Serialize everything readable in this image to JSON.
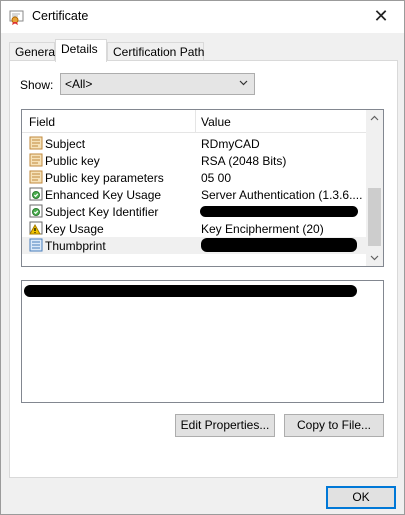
{
  "window": {
    "title": "Certificate",
    "close_glyph": "✕"
  },
  "tabs": [
    {
      "label": "General"
    },
    {
      "label": "Details"
    },
    {
      "label": "Certification Path"
    }
  ],
  "active_tab": "Details",
  "show": {
    "label": "Show:",
    "value": "<All>"
  },
  "list": {
    "columns": {
      "field": "Field",
      "value": "Value"
    },
    "rows": [
      {
        "field": "Subject",
        "value": "RDmyCAD",
        "icon": "certificate-field-icon"
      },
      {
        "field": "Public key",
        "value": "RSA (2048 Bits)",
        "icon": "certificate-field-icon"
      },
      {
        "field": "Public key parameters",
        "value": "05 00",
        "icon": "certificate-field-icon"
      },
      {
        "field": "Enhanced Key Usage",
        "value": "Server Authentication (1.3.6....",
        "icon": "extension-icon"
      },
      {
        "field": "Subject Key Identifier",
        "value": "",
        "icon": "extension-icon"
      },
      {
        "field": "Key Usage",
        "value": "Key Encipherment (20)",
        "icon": "critical-extension-icon"
      },
      {
        "field": "Thumbprint",
        "value": "",
        "icon": "property-icon"
      }
    ]
  },
  "buttons": {
    "edit_properties": "Edit Properties...",
    "copy_to_file": "Copy to File...",
    "ok": "OK"
  },
  "colors": {
    "accent": "#0078d7",
    "selected_row": "#f0f0f0"
  }
}
